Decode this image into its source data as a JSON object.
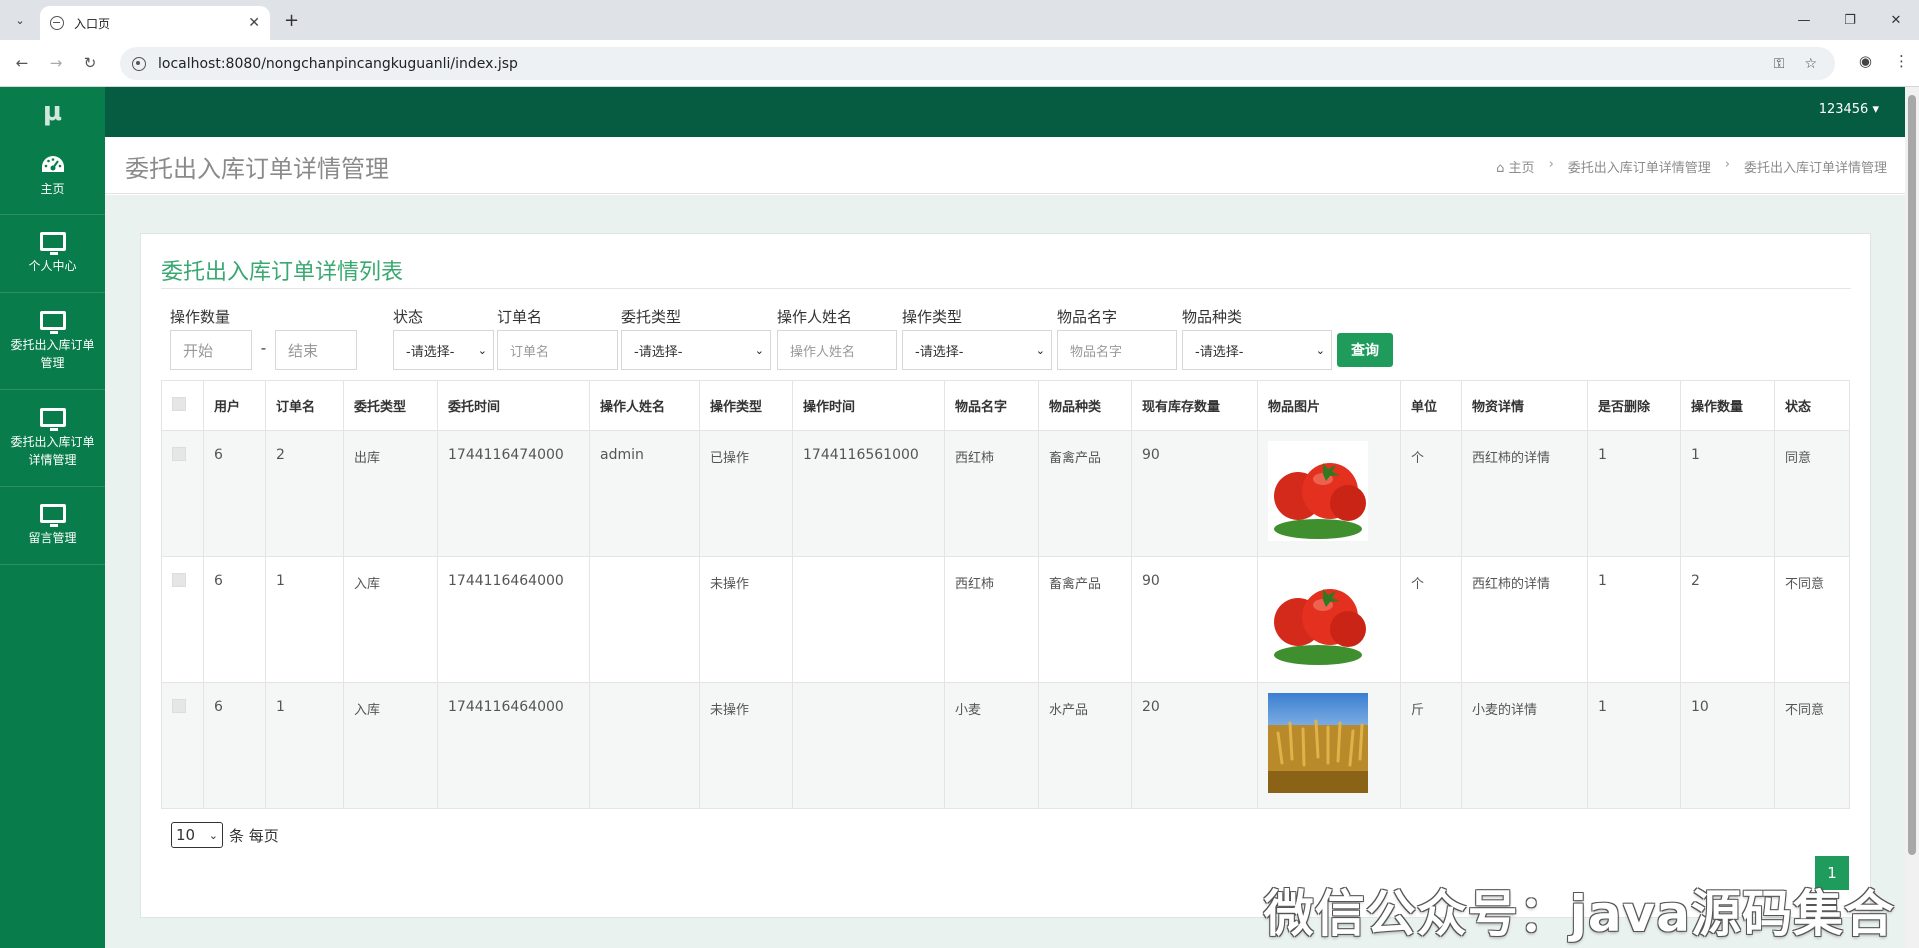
{
  "browser": {
    "tab_title": "入口页",
    "url": "localhost:8080/nongchanpincangkuguanli/index.jsp"
  },
  "app": {
    "brand": "μ",
    "user": "123456 ▾"
  },
  "sidebar": {
    "items": [
      {
        "label": "主页",
        "icon": "dashboard-icon"
      },
      {
        "label": "个人中心",
        "icon": "monitor-icon"
      },
      {
        "label": "委托出入库订单管理",
        "icon": "monitor-icon"
      },
      {
        "label": "委托出入库订单详情管理",
        "icon": "monitor-icon"
      },
      {
        "label": "留言管理",
        "icon": "monitor-icon"
      }
    ]
  },
  "header": {
    "title": "委托出入库订单详情管理",
    "breadcrumb": [
      "主页",
      "委托出入库订单详情管理",
      "委托出入库订单详情管理"
    ]
  },
  "card": {
    "title": "委托出入库订单详情列表"
  },
  "search": {
    "qty_label": "操作数量",
    "qty_start_placeholder": "开始",
    "qty_end_placeholder": "结束",
    "status_label": "状态",
    "status_value": "-请选择-",
    "order_label": "订单名",
    "order_placeholder": "订单名",
    "entrust_label": "委托类型",
    "entrust_value": "-请选择-",
    "operator_label": "操作人姓名",
    "operator_placeholder": "操作人姓名",
    "optype_label": "操作类型",
    "optype_value": "-请选择-",
    "goods_label": "物品名字",
    "goods_placeholder": "物品名字",
    "category_label": "物品种类",
    "category_value": "-请选择-",
    "query_button": "查询"
  },
  "table": {
    "headers": [
      "用户",
      "订单名",
      "委托类型",
      "委托时间",
      "操作人姓名",
      "操作类型",
      "操作时间",
      "物品名字",
      "物品种类",
      "现有库存数量",
      "物品图片",
      "单位",
      "物资详情",
      "是否删除",
      "操作数量",
      "状态"
    ],
    "rows": [
      {
        "user": "6",
        "order": "2",
        "entrust_type": "出库",
        "entrust_time": "1744116474000",
        "operator": "admin",
        "op_type": "已操作",
        "op_time": "1744116561000",
        "goods": "西红柿",
        "category": "畜禽产品",
        "stock": "90",
        "image": "tomato",
        "unit": "个",
        "detail": "西红柿的详情",
        "deleted": "1",
        "qty": "1",
        "status": "同意"
      },
      {
        "user": "6",
        "order": "1",
        "entrust_type": "入库",
        "entrust_time": "1744116464000",
        "operator": "",
        "op_type": "未操作",
        "op_time": "",
        "goods": "西红柿",
        "category": "畜禽产品",
        "stock": "90",
        "image": "tomato",
        "unit": "个",
        "detail": "西红柿的详情",
        "deleted": "1",
        "qty": "2",
        "status": "不同意"
      },
      {
        "user": "6",
        "order": "1",
        "entrust_type": "入库",
        "entrust_time": "1744116464000",
        "operator": "",
        "op_type": "未操作",
        "op_time": "",
        "goods": "小麦",
        "category": "水产品",
        "stock": "20",
        "image": "wheat",
        "unit": "斤",
        "detail": "小麦的详情",
        "deleted": "1",
        "qty": "10",
        "status": "不同意"
      }
    ]
  },
  "pagination": {
    "page_size": "10",
    "page_size_label": "条 每页",
    "current_page": "1"
  },
  "watermark": "微信公众号：java源码集合",
  "colors": {
    "sidebar": "#087c4a",
    "topbar": "#055c40",
    "accent": "#1f9c5c",
    "card_title": "#3aa871"
  }
}
